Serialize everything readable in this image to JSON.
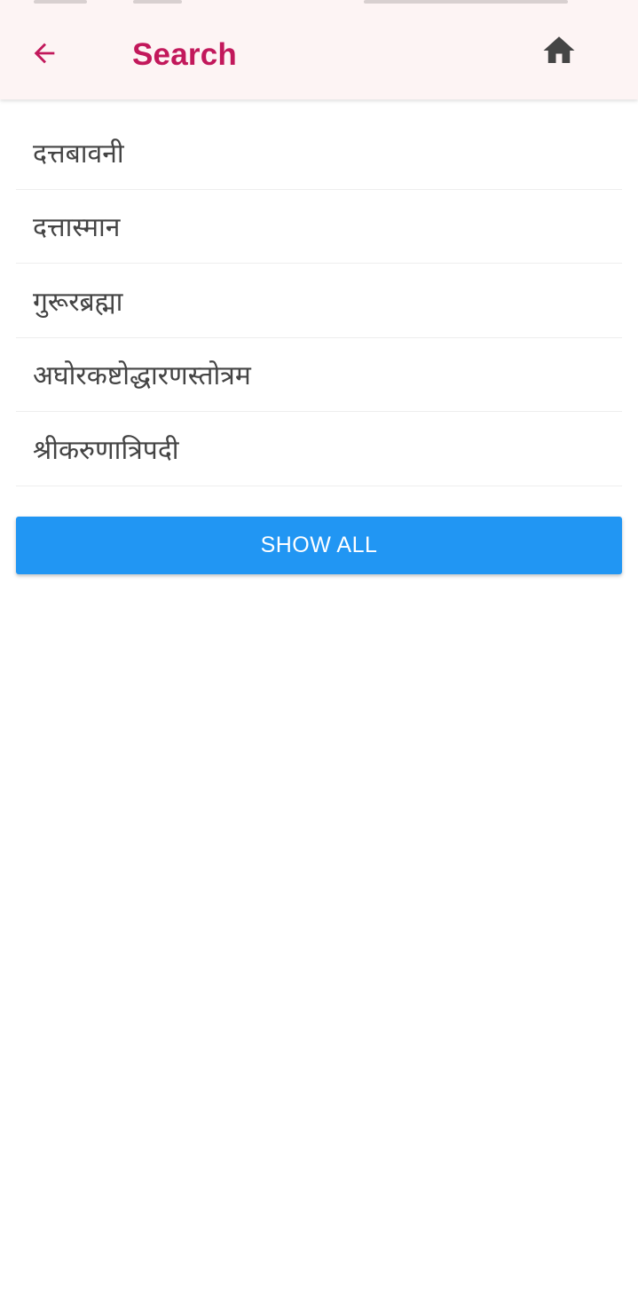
{
  "header": {
    "title": "Search",
    "back_icon": "arrow-left-icon",
    "home_icon": "home-icon",
    "accent_color": "#c2185b",
    "background_color": "#fdf4f4"
  },
  "results": {
    "items": [
      {
        "label": "दत्तबावनी"
      },
      {
        "label": "दत्तास्मान"
      },
      {
        "label": "गुरूरब्रह्मा"
      },
      {
        "label": "अघोरकष्टोद्धारणस्तोत्रम"
      },
      {
        "label": "श्रीकरुणात्रिपदी"
      }
    ]
  },
  "actions": {
    "show_all_label": "SHOW ALL",
    "show_all_color": "#2196f3"
  }
}
